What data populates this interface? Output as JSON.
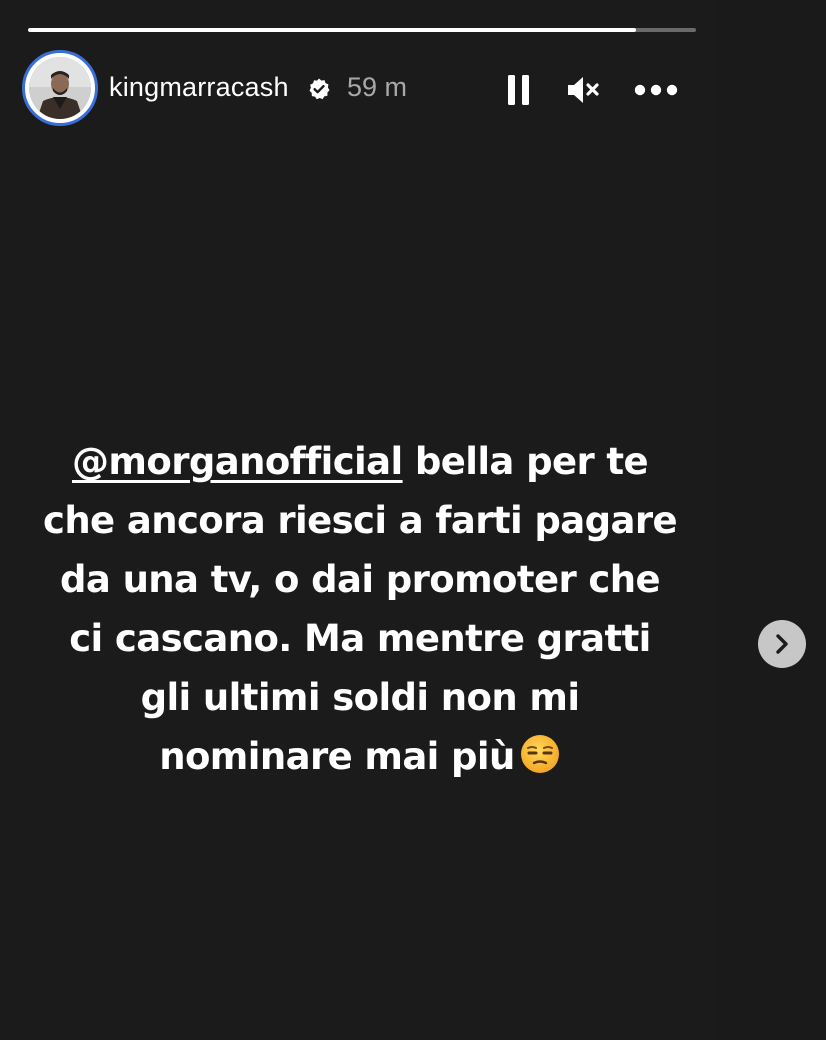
{
  "story": {
    "progress_fraction": 0.91,
    "username": "kingmarracash",
    "verified": true,
    "time_ago": "59 m",
    "controls": {
      "pause_icon": "pause-icon",
      "mute_icon": "volume-muted-icon",
      "more_icon": "more-options-icon"
    },
    "caption": {
      "mention": "@morganofficial",
      "text": " bella per te che ancora riesci a farti pagare da una tv, o dai promoter che ci cascano. Ma mentre gratti gli ultimi soldi non mi nominare mai più",
      "emoji": "unamused-face-emoji"
    },
    "next_icon": "chevron-right-icon"
  },
  "colors": {
    "background": "#1b1b1b",
    "text": "#ffffff",
    "muted_text": "#a8a8a8",
    "avatar_ring": "#3b6fd8",
    "next_button": "#c7c7c7"
  }
}
